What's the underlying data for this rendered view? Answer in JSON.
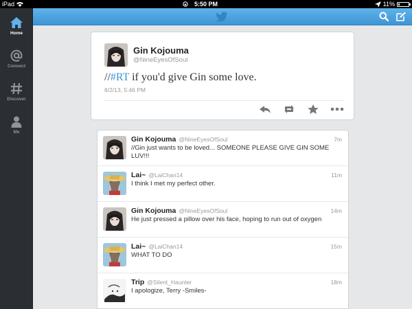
{
  "status_bar": {
    "device": "iPad",
    "time": "5:50 PM",
    "battery": "11%",
    "battery_level": 0.11
  },
  "sidebar": {
    "items": [
      {
        "label": "Home",
        "icon": "home-icon",
        "active": true
      },
      {
        "label": "Connect",
        "icon": "at-icon",
        "active": false
      },
      {
        "label": "Discover",
        "icon": "hash-icon",
        "active": false
      },
      {
        "label": "Me",
        "icon": "person-icon",
        "active": false
      }
    ]
  },
  "topbar": {
    "logo": "twitter-bird-icon",
    "search_icon": "search-icon",
    "compose_icon": "compose-icon"
  },
  "focused_tweet": {
    "name": "Gin Kojouma",
    "handle": "@NineEyesOfSoul",
    "text_prefix": "//",
    "hashtag": "#RT",
    "text_suffix": " if you'd give Gin some love.",
    "timestamp": "8/2/13, 5:46 PM",
    "actions": [
      "reply-icon",
      "retweet-icon",
      "favorite-icon",
      "more-icon"
    ]
  },
  "timeline": [
    {
      "name": "Gin Kojouma",
      "handle": "@NineEyesOfSoul",
      "age": "7m",
      "text": "//Gin just wants to be loved... SOMEONE PLEASE GIVE GIN SOME LUV!!!",
      "avatar": "gin"
    },
    {
      "name": "Lai~",
      "handle": "@LaiChan14",
      "age": "11m",
      "text": "I think I met my perfect other.",
      "avatar": "lai"
    },
    {
      "name": "Gin Kojouma",
      "handle": "@NineEyesOfSoul",
      "age": "14m",
      "text": "He just pressed a pillow over his face, hoping to run out of oxygen",
      "avatar": "gin"
    },
    {
      "name": "Lai~",
      "handle": "@LaiChan14",
      "age": "15m",
      "text": "WHAT TO DO",
      "avatar": "lai"
    },
    {
      "name": "Trip",
      "handle": "@Silent_Haunter",
      "age": "18m",
      "text": "I apologize, Terry -Smiles-",
      "avatar": "trip"
    }
  ],
  "colors": {
    "accent": "#3b94d9",
    "topbar": "#4aa3e0",
    "sidebar": "#2b2f33",
    "background": "#e5e7e9"
  }
}
